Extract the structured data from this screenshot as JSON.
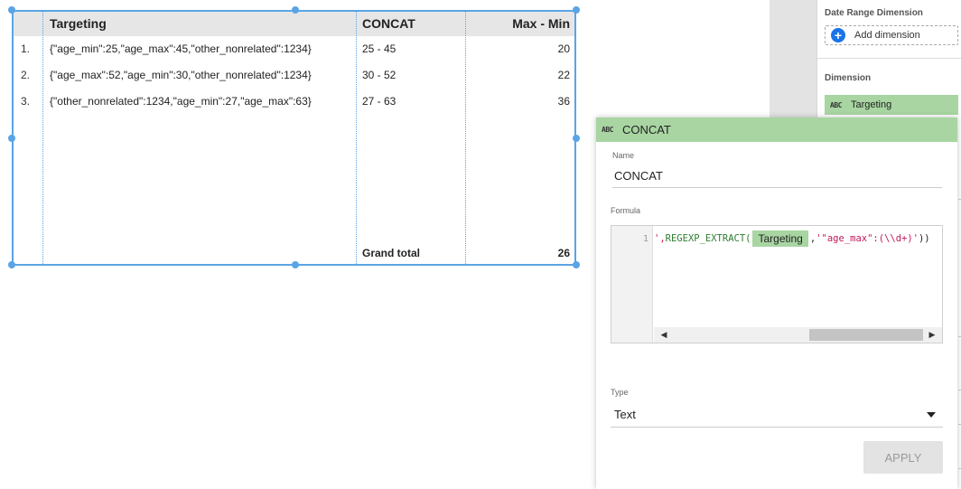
{
  "table": {
    "columns": [
      "Targeting",
      "CONCAT",
      "Max - Min"
    ],
    "rows": [
      {
        "num": "1.",
        "targeting": "{\"age_min\":25,\"age_max\":45,\"other_nonrelated\":1234}",
        "concat": "25 - 45",
        "maxmin": "20"
      },
      {
        "num": "2.",
        "targeting": "{\"age_max\":52,\"age_min\":30,\"other_nonrelated\":1234}",
        "concat": "30 - 52",
        "maxmin": "22"
      },
      {
        "num": "3.",
        "targeting": "{\"other_nonrelated\":1234,\"age_min\":27,\"age_max\":63}",
        "concat": "27 - 63",
        "maxmin": "36"
      }
    ],
    "grand_total_label": "Grand total",
    "grand_total_value": "26"
  },
  "properties": {
    "date_range_label": "Date Range Dimension",
    "add_dimension_label": "Add dimension",
    "dimension_label": "Dimension",
    "dimension_chip": {
      "type_icon": "ABC",
      "label": "Targeting"
    }
  },
  "dialog": {
    "type_icon": "ABC",
    "title": "CONCAT",
    "name_label": "Name",
    "name_value": "CONCAT",
    "formula_label": "Formula",
    "line_number": "1",
    "formula": {
      "prefix": "', ",
      "function": "REGEXP_EXTRACT(",
      "field_token": "Targeting",
      "separator": " , ",
      "pattern": "'\"age_max\":(\\\\d+)'",
      "suffix": "))"
    },
    "type_label": "Type",
    "type_value": "Text",
    "apply_label": "APPLY"
  },
  "colors": {
    "accent_blue": "#5aa4e6",
    "chip_green": "#a8d5a2",
    "button_blue": "#1a73e8"
  }
}
